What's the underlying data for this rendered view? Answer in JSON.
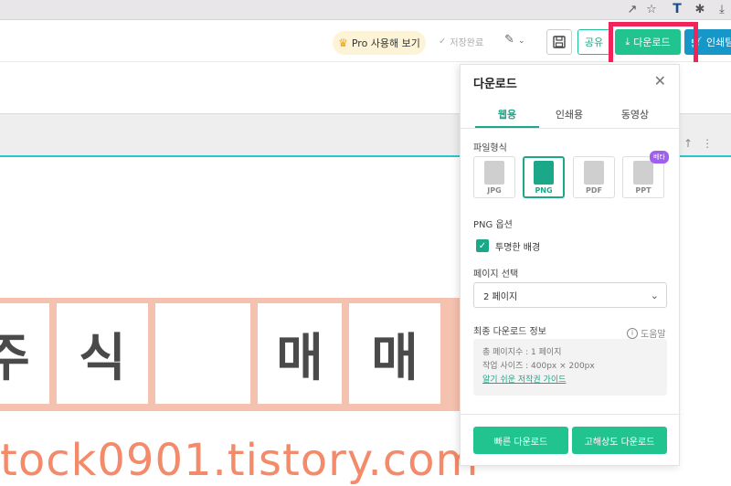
{
  "browser": {
    "icons": [
      "share-icon",
      "star-icon",
      "translate-icon",
      "extension-icon",
      "download-icon"
    ],
    "translate_glyph": "T"
  },
  "toolbar": {
    "pro_label": "Pro 사용해 보기",
    "saved_label": "저장완료",
    "share_label": "공유",
    "download_label": "다운로드",
    "print_label": "인쇄팀"
  },
  "canvas": {
    "tiles": [
      "주",
      "식",
      "",
      "매",
      "매"
    ],
    "bottom_text": "tock0901.tistory.com"
  },
  "panel": {
    "title": "다운로드",
    "tabs": [
      {
        "label": "웹용",
        "active": true
      },
      {
        "label": "인쇄용",
        "active": false
      },
      {
        "label": "동영상",
        "active": false
      }
    ],
    "file_format_label": "파일형식",
    "formats": [
      {
        "label": "JPG",
        "active": false
      },
      {
        "label": "PNG",
        "active": true
      },
      {
        "label": "PDF",
        "active": false
      },
      {
        "label": "PPT",
        "active": false
      }
    ],
    "beta_badge": "베타",
    "png_options_label": "PNG 옵션",
    "transparent_bg_label": "투명한 배경",
    "transparent_bg_checked": true,
    "page_select_label": "페이지 선택",
    "page_select_value": "2 페이지",
    "recent_info_label": "최종 다운로드 정보",
    "help_label": "도움말",
    "total_pages": "총 페이지수 : 1 페이지",
    "work_size": "작업 사이즈 : 400px × 200px",
    "copyright_link": "알기 쉬운 저작권 가이드",
    "fast_download": "빠른 다운로드",
    "hd_download": "고해상도 다운로드"
  },
  "colors": {
    "accent": "#21c48f",
    "accent_dark": "#1aa888",
    "highlight": "#f0245b",
    "print_blue": "#1796c8",
    "tile_bg": "#f6c2b0",
    "bottom_text": "#f38a6a",
    "beta": "#a05ff0"
  }
}
